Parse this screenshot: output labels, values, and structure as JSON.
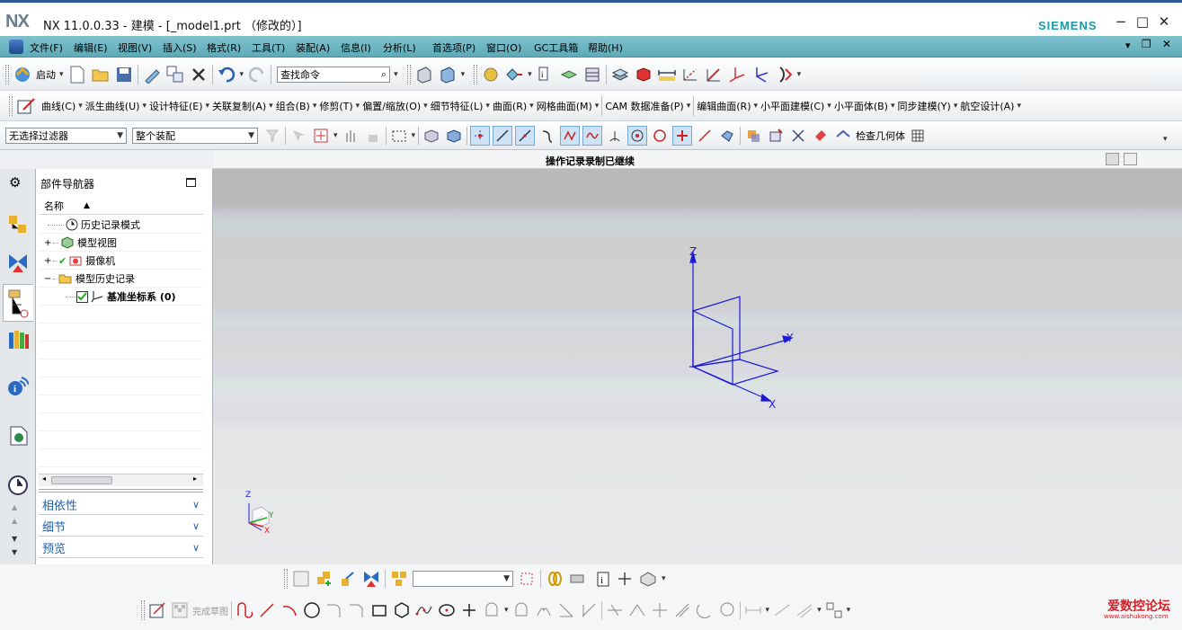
{
  "window": {
    "logo": "NX",
    "title": "NX 11.0.0.33 - 建模 - [_model1.prt （修改的）]",
    "brand": "SIEMENS",
    "minimize": "−",
    "maximize": "□",
    "close": "✕"
  },
  "menubar": {
    "items": [
      "文件(F)",
      "编辑(E)",
      "视图(V)",
      "插入(S)",
      "格式(R)",
      "工具(T)",
      "装配(A)",
      "信息(I)",
      "分析(L)",
      "首选项(P)",
      "窗口(O)",
      "GC工具箱",
      "帮助(H)"
    ]
  },
  "toolbar1": {
    "start_label": "启动",
    "search_placeholder": "查找命令"
  },
  "toolbar2": {
    "items": [
      "曲线(C)",
      "派生曲线(U)",
      "设计特征(E)",
      "关联复制(A)",
      "组合(B)",
      "修剪(T)",
      "偏置/缩放(O)",
      "细节特征(L)",
      "曲面(R)",
      "网格曲面(M)",
      "CAM 数据准备(P)",
      "编辑曲面(R)",
      "小平面建模(C)",
      "小平面体(B)",
      "同步建模(Y)",
      "航空设计(A)"
    ]
  },
  "toolbar3": {
    "filter_value": "无选择过滤器",
    "scope_value": "整个装配",
    "check_geometry": "检查几何体"
  },
  "status": {
    "text": "操作记录录制已继续"
  },
  "navigator": {
    "title": "部件导航器",
    "column_name": "名称",
    "tree": [
      {
        "label": "历史记录模式",
        "bold": false
      },
      {
        "label": "模型视图",
        "bold": false
      },
      {
        "label": "摄像机",
        "bold": false
      },
      {
        "label": "模型历史记录",
        "bold": false
      },
      {
        "label": "基准坐标系 (0)",
        "bold": true
      }
    ],
    "panels": [
      "相依性",
      "细节",
      "预览"
    ]
  },
  "viewport": {
    "axis_x": "X",
    "axis_y": "Y",
    "axis_z": "Z",
    "triad_x": "X",
    "triad_y": "Y",
    "triad_z": "Z",
    "csys_color": "#1a1ad6"
  },
  "sketch_toolbar": {
    "finish_label": "完成草图"
  },
  "watermark": {
    "title": "爱数控论坛",
    "url": "www.aishukong.com"
  },
  "colors": {
    "menubar": "#6ab4c2",
    "siemens": "#1d9aa6",
    "panel_text": "#1e5fb0"
  }
}
